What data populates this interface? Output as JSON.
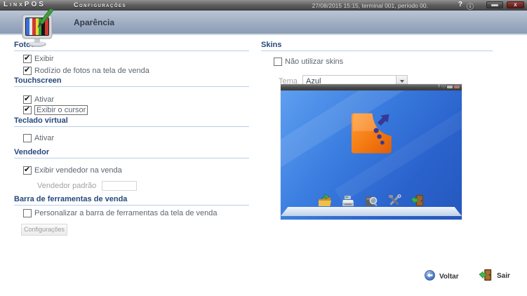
{
  "titlebar": {
    "logo": "LinxPOS",
    "title": "Configurações",
    "status": "27/08/2015 15:15, terminal 001, período 00.",
    "help_glyph": "?",
    "info_glyph": "ⓘ",
    "close_glyph": "x"
  },
  "banner": {
    "title": "Aparência"
  },
  "sections": {
    "fotos": {
      "title": "Fotos",
      "exibir": "Exibir",
      "rodizio": "Rodízio de fotos na tela de venda"
    },
    "touchscreen": {
      "title": "Touchscreen",
      "ativar": "Ativar",
      "exibir_cursor": "Exibir o cursor"
    },
    "teclado": {
      "title": "Teclado virtual",
      "ativar": "Ativar"
    },
    "vendedor": {
      "title": "Vendedor",
      "exibir_vendedor": "Exibir vendedor na venda",
      "padrao_label": "Vendedor padrão",
      "padrao_value": ""
    },
    "barra": {
      "title": "Barra de ferramentas de venda",
      "personalizar": "Personalizar a barra de ferramentas da tela de venda",
      "config_button": "Configurações"
    },
    "skins": {
      "title": "Skins",
      "nao_utilizar": "Não utilizar skins",
      "tema_label": "Tema",
      "tema_value": "Azul"
    }
  },
  "checks": {
    "fotos_exibir": true,
    "fotos_rodizio": true,
    "touch_ativar": true,
    "touch_cursor": true,
    "teclado_ativar": false,
    "vendedor_exibir": true,
    "barra_personalizar": false,
    "skins_nao_utilizar": false
  },
  "preview": {
    "help_glyph": "?",
    "info_glyph": "ⓘ"
  },
  "footer": {
    "voltar": "Voltar",
    "sair": "Sair"
  },
  "colors": {
    "banner_blue": "#9fadc2",
    "section_title": "#27497d",
    "underline": "#b9cfe7",
    "preview_blue": "#2f6fd6",
    "logo_orange": "#f47a12",
    "logo_navy": "#343a96"
  }
}
